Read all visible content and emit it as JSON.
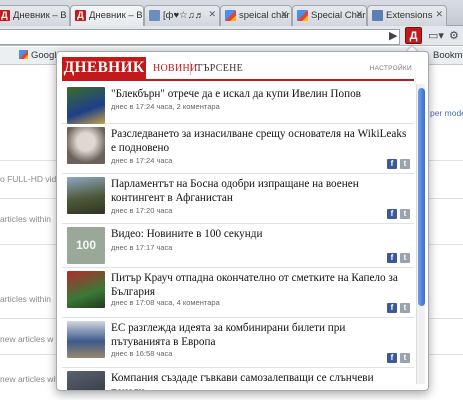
{
  "tabs": [
    {
      "label": "Дневник – В",
      "fav": "dn"
    },
    {
      "label": "Дневник – В",
      "fav": "dn"
    },
    {
      "label": "[ф♥☆♫♬",
      "fav": "misc"
    },
    {
      "label": "speical char",
      "fav": "g"
    },
    {
      "label": "Special Char",
      "fav": "g"
    },
    {
      "label": "Extensions",
      "fav": "ext"
    }
  ],
  "toolbar": {
    "dnevnik_button": "Д",
    "bookmark_right": "Bookma"
  },
  "bookmarks": [
    "Google"
  ],
  "background": {
    "lines": [
      "o FULL-HD video",
      "articles within",
      "articles within",
      "new articles w",
      "new articles with"
    ],
    "right_link": "per mode"
  },
  "popup": {
    "logo": "ДНЕВНИК",
    "tab_news": "НОВИНИ",
    "tab_search": "ТЪРСЕНЕ",
    "settings": "НАСТРОЙКИ",
    "items": [
      {
        "title": "\"Блекбърн\" отрече да е искал да купи Ивелин Попов",
        "meta": "днес в 17:24 часа, 2 коментара"
      },
      {
        "title": "Разследването за изнасилване срещу основателя на WikiLeaks е подновено",
        "meta": "днес в 17:24 часа"
      },
      {
        "title": "Парламентът на Босна одобри изпращане на военен контингент в Афганистан",
        "meta": "днес в 17:20 часа"
      },
      {
        "title": "Видео: Новините в 100 секунди",
        "meta": "днес в 17:17 часа",
        "thumb_text": "100"
      },
      {
        "title": "Питър Крауч отпадна окончателно от сметките на Капело за България",
        "meta": "днес в 17:08 часа, 4 коментара"
      },
      {
        "title": "ЕС разглежда идеята за комбинирани билети при пътуванията в Европа",
        "meta": "днес в 16:58 часа"
      },
      {
        "title": "Компания създаде гъвкави самозалепващи се слънчеви панели",
        "meta": ""
      }
    ]
  }
}
